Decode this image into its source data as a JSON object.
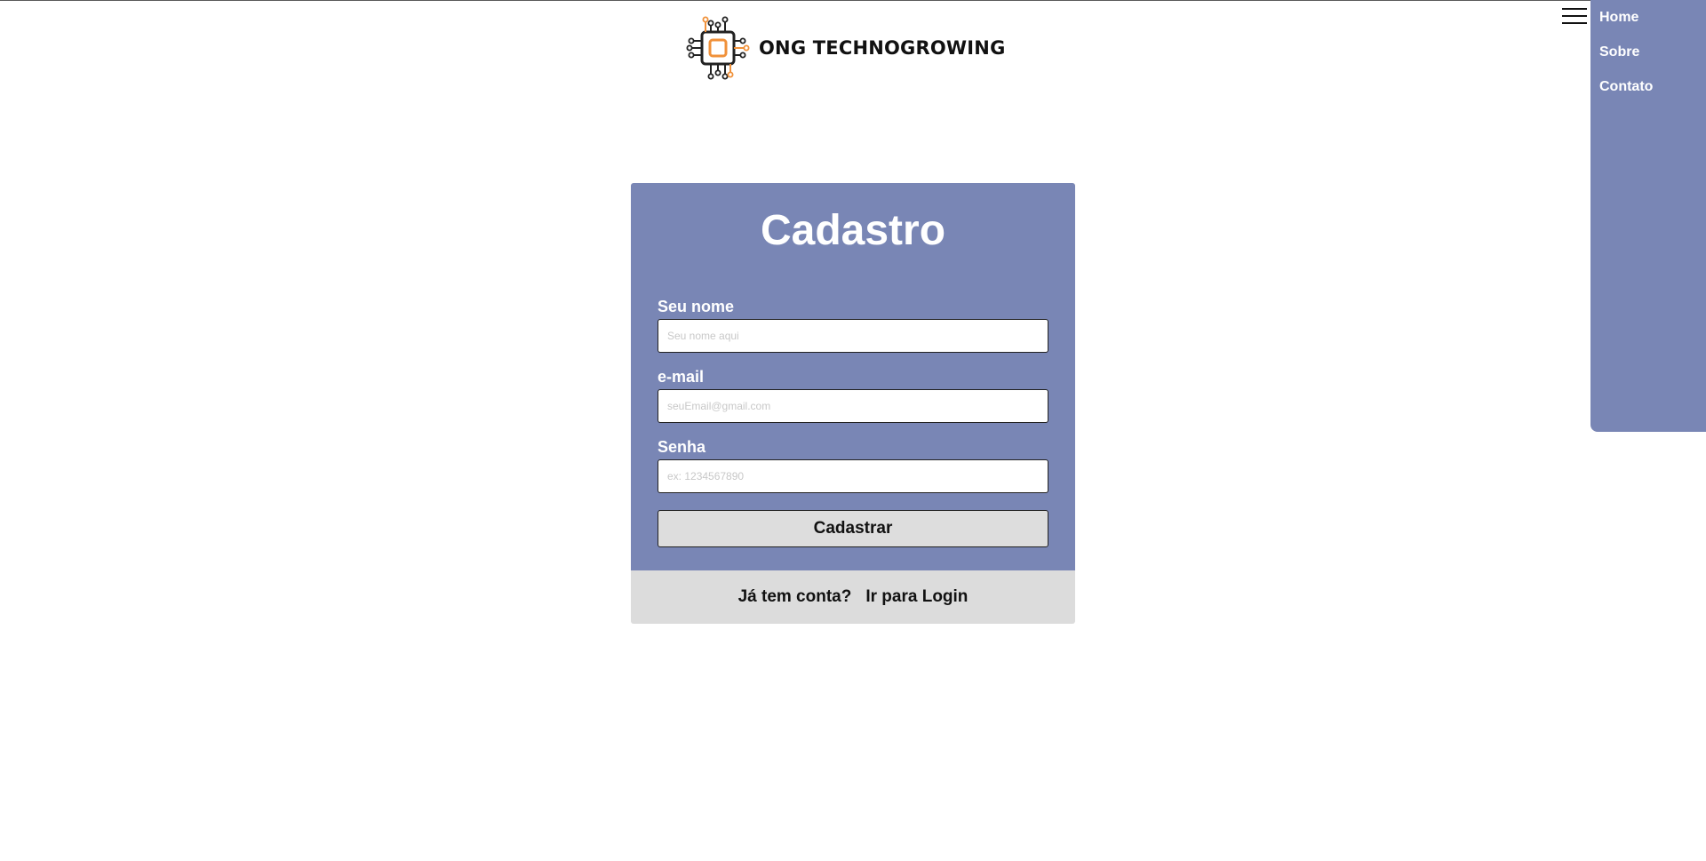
{
  "header": {
    "brand": "ONG TECHNOGROWING",
    "logo_icon": "circuit-chip-icon"
  },
  "nav": {
    "menu_icon": "hamburger-menu-icon",
    "items": [
      {
        "label": "Home"
      },
      {
        "label": "Sobre"
      },
      {
        "label": "Contato"
      }
    ]
  },
  "form": {
    "title": "Cadastro",
    "fields": [
      {
        "label": "Seu nome",
        "placeholder": "Seu nome aqui",
        "value": ""
      },
      {
        "label": "e-mail",
        "placeholder": "seuEmail@gmail.com",
        "value": ""
      },
      {
        "label": "Senha",
        "placeholder": "ex: 1234567890",
        "value": ""
      }
    ],
    "submit_label": "Cadastrar"
  },
  "footer": {
    "question": "Já tem conta?",
    "login_link": "Ir para Login"
  },
  "colors": {
    "panel": "#7986b5",
    "footer_bg": "#dcdcdc",
    "logo_orange": "#f0913a",
    "logo_dark": "#222222"
  }
}
